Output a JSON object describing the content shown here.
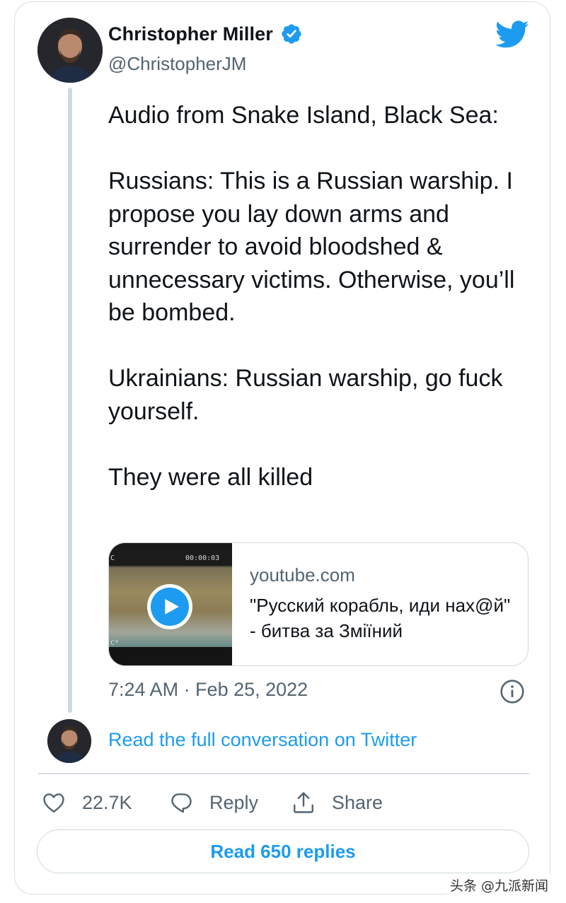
{
  "author": {
    "name": "Christopher Miller",
    "handle": "@ChristopherJM",
    "verified": true,
    "avatar_icon": "avatar-photo"
  },
  "brand": {
    "logo_icon": "twitter-bird-icon",
    "accent_color": "#1d9bf0"
  },
  "tweet": {
    "paragraphs": [
      "Audio from Snake Island, Black Sea:",
      "Russians: This is a Russian warship. I propose you lay down arms and surrender to avoid bloodshed & unnecessary victims. Otherwise, you’ll be bombed.",
      "Ukrainians: Russian warship, go fuck yourself.",
      "They were all killed"
    ],
    "timestamp": "7:24 AM · Feb 25, 2022"
  },
  "link_card": {
    "domain": "youtube.com",
    "title": "\"Русский корабль, иди нах@й\" - битва за Зміїний",
    "thumbnail_overlay": {
      "timecode": "00:00:03",
      "corner_top": "C",
      "corner_bottom": "C*"
    }
  },
  "conversation_link": "Read the full conversation on Twitter",
  "actions": {
    "likes": "22.7K",
    "reply_label": "Reply",
    "share_label": "Share"
  },
  "read_replies_label": "Read 650 replies",
  "watermark": "头条 @九派新闻"
}
